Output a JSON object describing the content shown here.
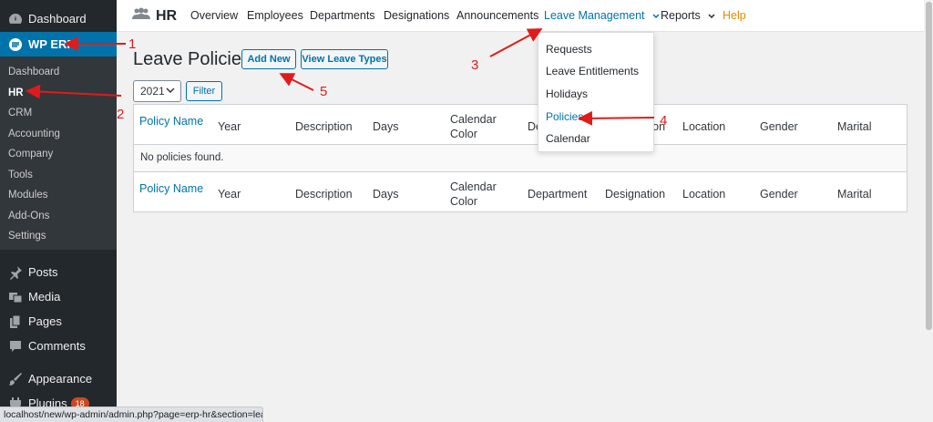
{
  "sidebar": {
    "dashboard": "Dashboard",
    "wp_erp": "WP ERP",
    "submenu": [
      "Dashboard",
      "HR",
      "CRM",
      "Accounting",
      "Company",
      "Tools",
      "Modules",
      "Add-Ons",
      "Settings"
    ],
    "posts": "Posts",
    "media": "Media",
    "pages": "Pages",
    "comments": "Comments",
    "appearance": "Appearance",
    "plugins": "Plugins",
    "plugins_badge": "18"
  },
  "topnav": {
    "brand": "HR",
    "links": [
      "Overview",
      "Employees",
      "Departments",
      "Designations",
      "Announcements",
      "Leave Management",
      "Reports",
      "Help"
    ]
  },
  "dropdown": {
    "items": [
      "Requests",
      "Leave Entitlements",
      "Holidays",
      "Policies",
      "Calendar"
    ]
  },
  "page": {
    "title": "Leave Policies",
    "add_new": "Add New",
    "view_types": "View Leave Types",
    "year": "2021",
    "filter": "Filter"
  },
  "table": {
    "columns": [
      "Policy Name",
      "Year",
      "Description",
      "Days",
      "Calendar Color",
      "Department",
      "Designation",
      "Location",
      "Gender",
      "Marital"
    ],
    "empty": "No policies found."
  },
  "annotations": [
    "1",
    "2",
    "3",
    "4",
    "5"
  ],
  "statusbar": "localhost/new/wp-admin/admin.php?page=erp-hr&section=leave",
  "colors": {
    "accent": "#0073aa",
    "sidebar": "#23282d",
    "annotation": "#e01b1b"
  }
}
